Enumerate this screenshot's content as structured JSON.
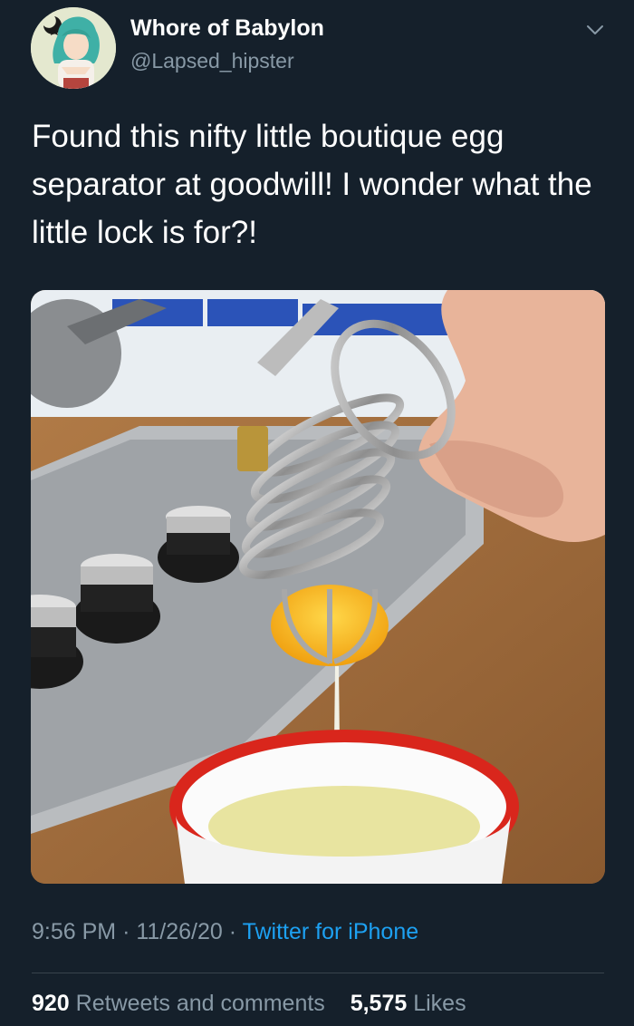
{
  "tweet": {
    "author": {
      "display_name": "Whore of Babylon",
      "handle": "@Lapsed_hipster",
      "avatar": "anime-character-avatar"
    },
    "menu_icon": "chevron-down-icon",
    "text": "Found this nifty little boutique egg separator at goodwill! I wonder what the little lock is for?!",
    "media": {
      "type": "photo",
      "subject": "metal coil cage with padlock over white bowl with red rim, egg yolk held in cage, stovetop knobs in background"
    },
    "time": "9:56 PM",
    "separator": "·",
    "date": "11/26/20",
    "source": "Twitter for iPhone",
    "stats": {
      "retweets_count": "920",
      "retweets_label": "Retweets and comments",
      "likes_count": "5,575",
      "likes_label": "Likes"
    }
  },
  "colors": {
    "background": "#15202b",
    "primary_text": "#ffffff",
    "secondary_text": "#8899a6",
    "link": "#1da1f2",
    "divider": "#38444d"
  }
}
